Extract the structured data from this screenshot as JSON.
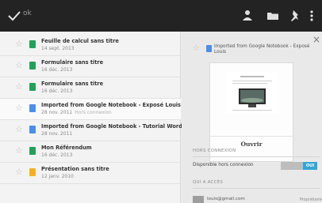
{
  "topbar": {
    "done_label": "ok",
    "icons": [
      "person-icon",
      "folder-icon",
      "pin-icon",
      "overflow-menu-icon"
    ],
    "background": "#232323"
  },
  "documents": [
    {
      "title": "Feuille de calcul sans titre",
      "date": "14 sept. 2013",
      "extra": "",
      "type": "sheet",
      "color": "#24a05a"
    },
    {
      "title": "Formulaire sans titre",
      "date": "16 déc. 2013",
      "extra": "",
      "type": "form",
      "color": "#24a05a"
    },
    {
      "title": "Formulaire sans titre",
      "date": "16 déc. 2013",
      "extra": "",
      "type": "form",
      "color": "#24a05a"
    },
    {
      "title": "Imported from Google Notebook - Exposé Louis",
      "date": "28 nov. 2011",
      "extra": "Hors connexion",
      "type": "doc",
      "color": "#4e8de8"
    },
    {
      "title": "Imported from Google Notebook - Tutorial Word",
      "date": "28 nov. 2011",
      "extra": "",
      "type": "doc",
      "color": "#4e8de8"
    },
    {
      "title": "Mon Référendum",
      "date": "16 déc. 2013",
      "extra": "",
      "type": "form",
      "color": "#24a05a"
    },
    {
      "title": "Présentation sans titre",
      "date": "12 janv. 2010",
      "extra": "",
      "type": "slides",
      "color": "#f2b125"
    }
  ],
  "detail": {
    "title": "Imported from Google Notebook - Exposé Louis",
    "open_label": "Ouvrir",
    "offline_section": "HORS CONNEXION",
    "offline_label": "Disponible hors connexion",
    "offline_toggle": "OUI",
    "access_section": "QUI A ACCÈS",
    "access_email": "louis@gmail.com",
    "access_role": "Propriétaire",
    "accent": "#34a6d4"
  }
}
